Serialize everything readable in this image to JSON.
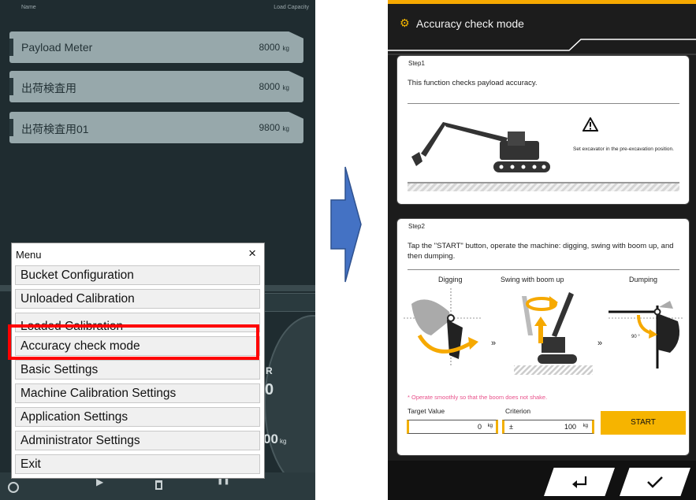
{
  "left": {
    "header": {
      "name": "Name",
      "load_capacity": "Load Capacity"
    },
    "meters": [
      {
        "name": "Payload Meter",
        "value": "8000",
        "unit": "kg"
      },
      {
        "name": "出荷検査用",
        "value": "8000",
        "unit": "kg"
      },
      {
        "name": "出荷検査用01",
        "value": "9800",
        "unit": "kg"
      }
    ],
    "menu": {
      "title": "Menu",
      "close": "×",
      "items": [
        "Bucket Configuration",
        "Unloaded Calibration",
        "Loaded Calibration",
        "Accuracy check mode",
        "Basic Settings",
        "Machine Calibration Settings",
        "Application Settings",
        "Administrator Settings",
        "Exit"
      ]
    },
    "gauge": {
      "partial_r": "R",
      "partial_0": "0",
      "partial_00": "00",
      "unit": "kg"
    },
    "bottom_bar": {
      "play": "▶",
      "pause": "❚❚"
    }
  },
  "right": {
    "title": "Accuracy check mode",
    "step1": {
      "label": "Step1",
      "description": "This function checks payload accuracy.",
      "note": "Set excavator in the pre-excavation position."
    },
    "step2": {
      "label": "Step2",
      "description": "Tap the \"START\" button, operate the machine: digging, swing with boom up, and then dumping.",
      "phases": [
        "Digging",
        "Swing with boom up",
        "Dumping"
      ],
      "warning": "* Operate smoothly so that the boom does not shake.",
      "angle": "90 °",
      "target_label": "Target Value",
      "target_value": "0",
      "target_unit": "kg",
      "criterion_label": "Criterion",
      "criterion_sign": "±",
      "criterion_value": "100",
      "criterion_unit": "kg",
      "start_label": "START"
    },
    "colors": {
      "accent": "#f6b400",
      "warning": "#e8508a"
    }
  }
}
